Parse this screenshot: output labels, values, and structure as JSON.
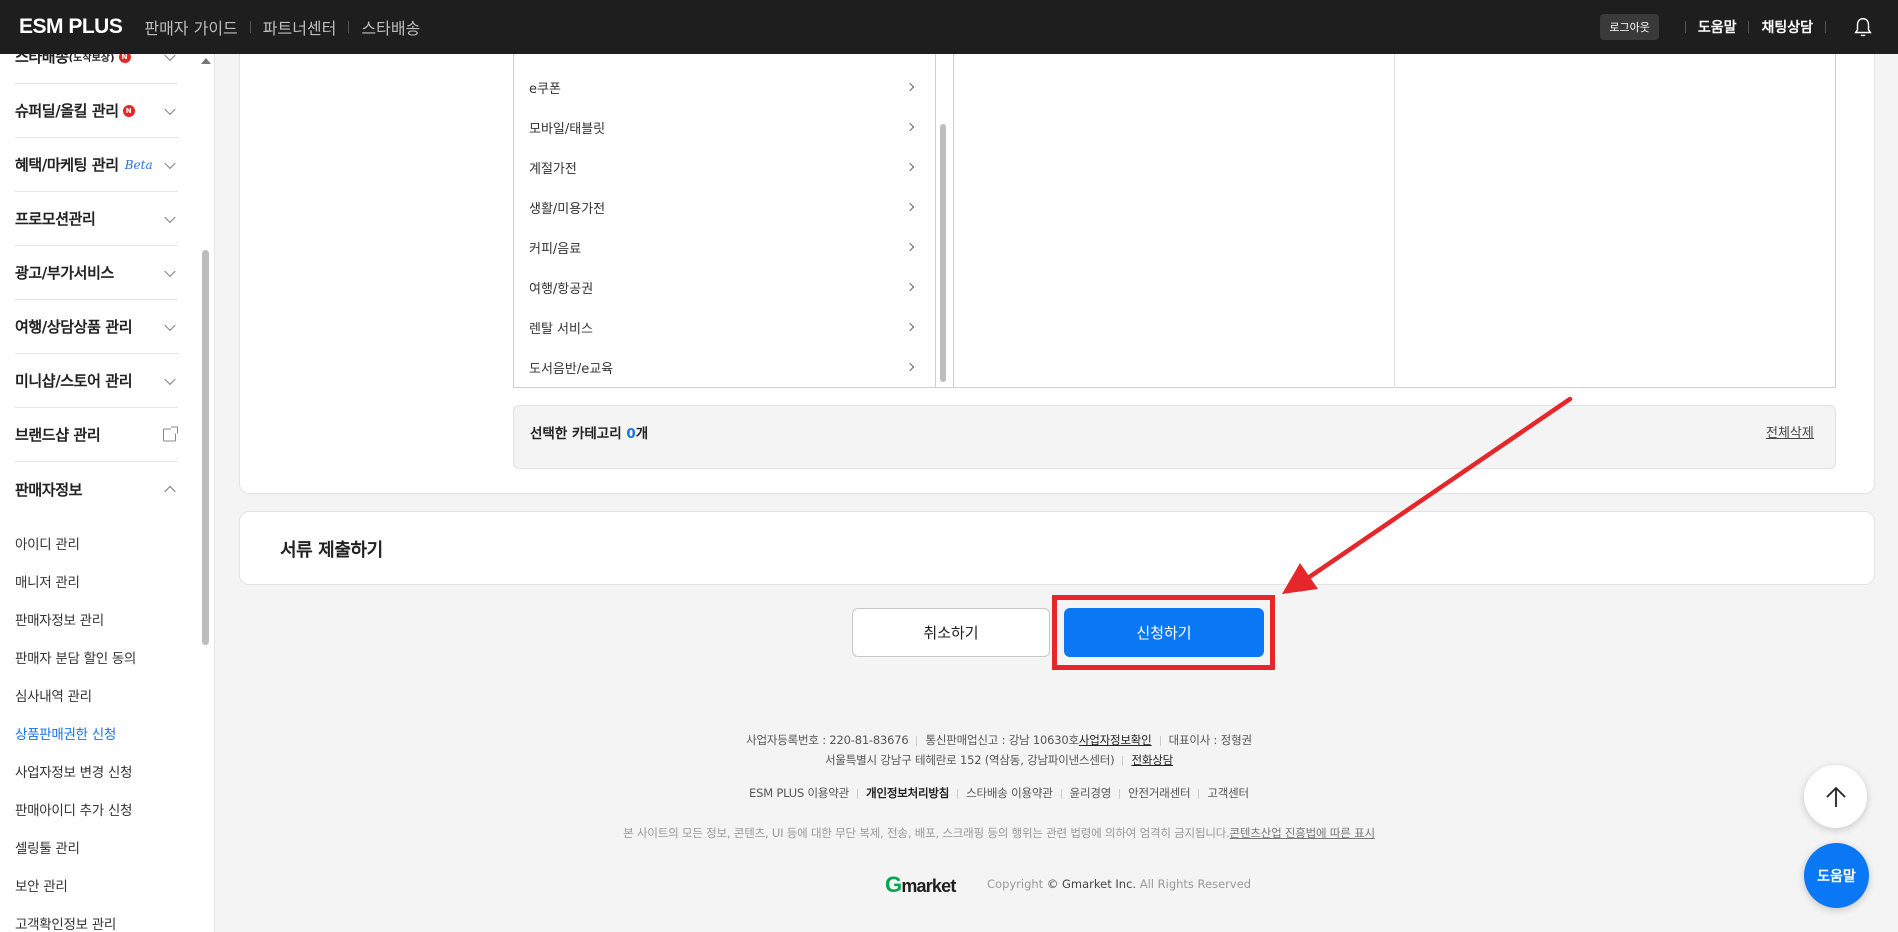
{
  "topbar": {
    "logo": "ESM PLUS",
    "nav": [
      "판매자 가이드",
      "파트너센터",
      "스타배송"
    ],
    "logout": "로그아웃",
    "help": "도움말",
    "chat": "채팅상담",
    "bell_icon": "bell-icon"
  },
  "sidebar": {
    "groups": [
      {
        "label": "스타배송",
        "sub": "(도착보장)",
        "badge": "N"
      },
      {
        "label": "슈퍼딜/올킬 관리",
        "badge": "N"
      },
      {
        "label": "혜택/마케팅 관리",
        "beta": "Beta"
      },
      {
        "label": "프로모션관리"
      },
      {
        "label": "광고/부가서비스"
      },
      {
        "label": "여행/상담상품 관리"
      },
      {
        "label": "미니샵/스토어 관리"
      },
      {
        "label": "브랜드샵 관리"
      },
      {
        "label": "판매자정보"
      }
    ],
    "sub_items": [
      "아이디 관리",
      "매니저 관리",
      "판매자정보 관리",
      "판매자 분담 할인 동의",
      "심사내역 관리",
      "상품판매권한 신청",
      "사업자정보 변경 신청",
      "판매아이디 추가 신청",
      "셀링툴 관리",
      "보안 관리",
      "고객확인정보 관리"
    ],
    "active_item": "상품판매권한 신청"
  },
  "categories": {
    "items": [
      "e쿠폰",
      "모바일/태블릿",
      "계절가전",
      "생활/미용가전",
      "커피/음료",
      "여행/항공권",
      "렌탈 서비스",
      "도서음반/e교육"
    ]
  },
  "selected": {
    "label": "선택한 카테고리 ",
    "count": "0",
    "unit": "개",
    "clear_all": "전체삭제"
  },
  "document": {
    "title": "서류 제출하기"
  },
  "actions": {
    "cancel": "취소하기",
    "apply": "신청하기"
  },
  "footer": {
    "biz_no": "사업자등록번호 : 220-81-83676",
    "mail_order": "통신판매업신고 : 강남 10630호",
    "biz_check": "사업자정보확인",
    "ceo": "대표이사 : 정형권",
    "address": "서울특별시 강남구 테헤란로 152 (역삼동, 강남파이낸스센터)",
    "phone": "전화상담",
    "links": [
      "ESM PLUS 이용약관",
      "개인정보처리방침",
      "스타배송 이용약관",
      "윤리경영",
      "안전거래센터",
      "고객센터"
    ],
    "warning": "본 사이트의 모든 정보, 콘텐츠, UI 등에 대한 무단 복제, 전송, 배포, 스크래핑 등의 행위는 관련 법령에 의하여 엄격히 금지됩니다.",
    "warning_link": "콘텐츠산업 진흥법에 따른 표시",
    "brand_g": "G",
    "brand_rest": "market",
    "copyright_pre": "Copyright ",
    "copyright_main": "© Gmarket Inc.",
    "copyright_post": " All Rights Reserved"
  },
  "fab": {
    "help": "도움말",
    "top_icon": "arrow-up-icon"
  },
  "colors": {
    "accent": "#0a78f5",
    "highlight": "#e5262a",
    "topbar": "#1e1e1e"
  }
}
